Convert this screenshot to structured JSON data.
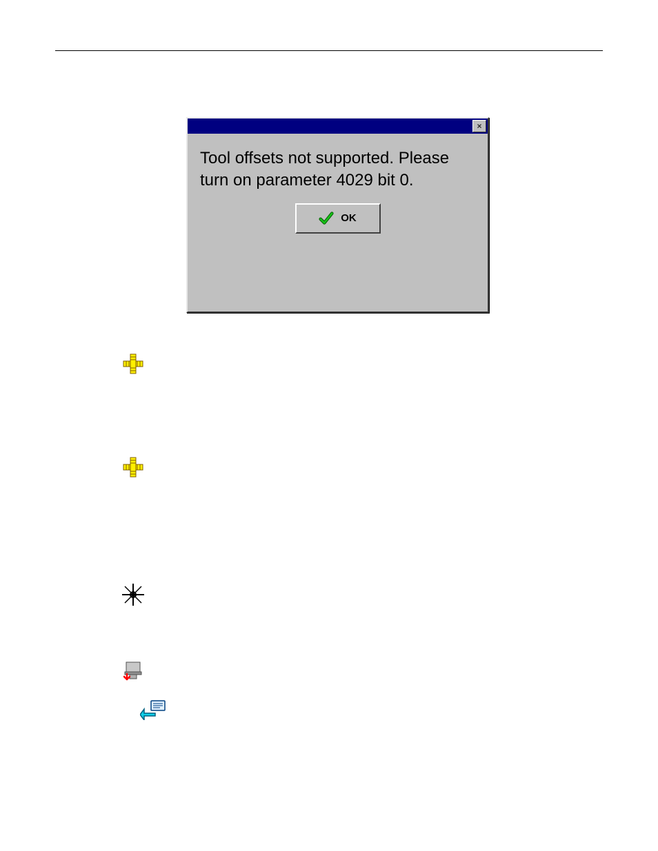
{
  "dialog": {
    "message": "Tool offsets not supported. Please turn on parameter 4029 bit 0.",
    "ok_label": "OK",
    "close_glyph": "×"
  },
  "icons": [
    {
      "name": "ruler-cross-icon"
    },
    {
      "name": "ruler-cross-icon"
    },
    {
      "name": "star-target-icon"
    },
    {
      "name": "machine-tool-icon"
    },
    {
      "name": "back-message-icon"
    }
  ]
}
